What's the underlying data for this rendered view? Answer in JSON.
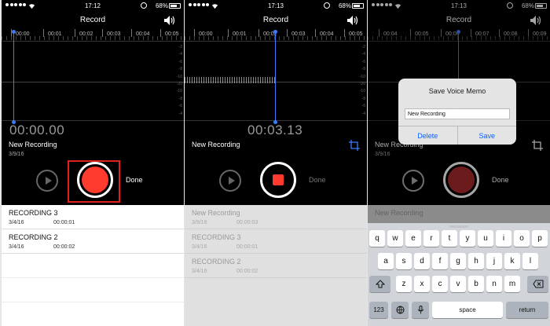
{
  "status": {
    "time_1": "17:12",
    "time_2": "17:13",
    "time_3": "17:13",
    "battery": "68%"
  },
  "nav": {
    "title": "Record"
  },
  "icons": {
    "speaker": "speaker-volume-icon",
    "crop": "crop-trim-icon",
    "wifi": "wifi-icon",
    "battery": "battery-icon",
    "alarm": "alarm-icon",
    "mic": "microphone-icon",
    "globe": "globe-icon",
    "shift": "shift-icon",
    "delete": "backspace-icon"
  },
  "colors": {
    "record_red": "#ff3b30",
    "accent_blue": "#0a60ff",
    "highlight_red": "#e0201c"
  },
  "panel1": {
    "ruler": [
      "00:00",
      "00:01",
      "00:02",
      "00:03",
      "00:04",
      "00:05"
    ],
    "timer": "00:00.00",
    "name": "New Recording",
    "date": "3/9/16",
    "done": "Done",
    "list": [
      {
        "title": "RECORDING 3",
        "date": "3/4/16",
        "duration": "00:00:01"
      },
      {
        "title": "RECORDING 2",
        "date": "3/4/16",
        "duration": "00:00:02"
      }
    ]
  },
  "panel2": {
    "ruler": [
      "00:00",
      "00:01",
      "00:02",
      "00:03",
      "00:04",
      "00:05"
    ],
    "timer": "00:03.13",
    "name": "New Recording",
    "done": "Done",
    "list": [
      {
        "title": "New Recording",
        "date": "3/9/16",
        "duration": "00:00:03"
      },
      {
        "title": "RECORDING 3",
        "date": "3/4/16",
        "duration": "00:00:01"
      },
      {
        "title": "RECORDING 2",
        "date": "3/4/16",
        "duration": "00:00:02"
      }
    ]
  },
  "panel3": {
    "ruler": [
      "00:04",
      "00:05",
      "00:06",
      "00:07",
      "00:08",
      "00:09"
    ],
    "name": "New Recording",
    "date": "3/9/16",
    "done": "Done",
    "dialog": {
      "title": "Save Voice Memo",
      "input_value": "New Recording",
      "delete": "Delete",
      "save": "Save"
    },
    "list_first": "New Recording"
  },
  "keyboard": {
    "row1": [
      "q",
      "w",
      "e",
      "r",
      "t",
      "y",
      "u",
      "i",
      "o",
      "p"
    ],
    "row2": [
      "a",
      "s",
      "d",
      "f",
      "g",
      "h",
      "j",
      "k",
      "l"
    ],
    "row3": [
      "z",
      "x",
      "c",
      "v",
      "b",
      "n",
      "m"
    ],
    "numbers": "123",
    "space": "space",
    "return": "return"
  },
  "db_scale": [
    "-2",
    "-4",
    "-6",
    "-8",
    "-10",
    "-20",
    "-10",
    "-8",
    "-6",
    "-4"
  ]
}
